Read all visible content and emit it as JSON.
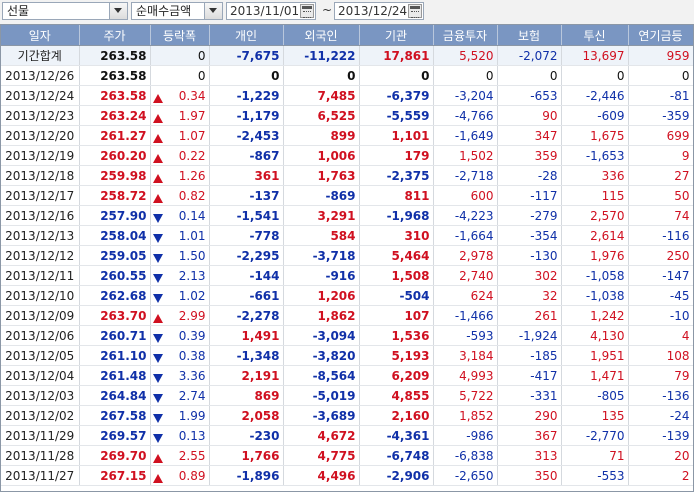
{
  "toolbar": {
    "market_select": "선물",
    "type_select": "순매수금액",
    "date_from": "2013/11/01",
    "date_to": "2013/12/24",
    "separator": "~"
  },
  "columns": [
    "일자",
    "주가",
    "등락폭",
    "개인",
    "외국인",
    "기관",
    "금융투자",
    "보험",
    "투신",
    "연기금등"
  ],
  "total": {
    "label": "기간합계",
    "price": "263.58",
    "chg": "0",
    "individual": "-7,675",
    "foreign": "-11,222",
    "inst": "17,861",
    "fin": "5,520",
    "insurance": "-2,072",
    "trust": "13,697",
    "pension": "959"
  },
  "rows": [
    {
      "date": "2013/12/26",
      "price": "263.58",
      "dir": "none",
      "chg": "0",
      "individual": "0",
      "foreign": "0",
      "inst": "0",
      "fin": "0",
      "insurance": "0",
      "trust": "0",
      "pension": "0"
    },
    {
      "date": "2013/12/24",
      "price": "263.58",
      "dir": "up",
      "chg": "0.34",
      "individual": "-1,229",
      "foreign": "7,485",
      "inst": "-6,379",
      "fin": "-3,204",
      "insurance": "-653",
      "trust": "-2,446",
      "pension": "-81"
    },
    {
      "date": "2013/12/23",
      "price": "263.24",
      "dir": "up",
      "chg": "1.97",
      "individual": "-1,179",
      "foreign": "6,525",
      "inst": "-5,559",
      "fin": "-4,766",
      "insurance": "90",
      "trust": "-609",
      "pension": "-359"
    },
    {
      "date": "2013/12/20",
      "price": "261.27",
      "dir": "up",
      "chg": "1.07",
      "individual": "-2,453",
      "foreign": "899",
      "inst": "1,101",
      "fin": "-1,649",
      "insurance": "347",
      "trust": "1,675",
      "pension": "699"
    },
    {
      "date": "2013/12/19",
      "price": "260.20",
      "dir": "up",
      "chg": "0.22",
      "individual": "-867",
      "foreign": "1,006",
      "inst": "179",
      "fin": "1,502",
      "insurance": "359",
      "trust": "-1,653",
      "pension": "9"
    },
    {
      "date": "2013/12/18",
      "price": "259.98",
      "dir": "up",
      "chg": "1.26",
      "individual": "361",
      "foreign": "1,763",
      "inst": "-2,375",
      "fin": "-2,718",
      "insurance": "-28",
      "trust": "336",
      "pension": "27"
    },
    {
      "date": "2013/12/17",
      "price": "258.72",
      "dir": "up",
      "chg": "0.82",
      "individual": "-137",
      "foreign": "-869",
      "inst": "811",
      "fin": "600",
      "insurance": "-117",
      "trust": "115",
      "pension": "50"
    },
    {
      "date": "2013/12/16",
      "price": "257.90",
      "dir": "down",
      "chg": "0.14",
      "individual": "-1,541",
      "foreign": "3,291",
      "inst": "-1,968",
      "fin": "-4,223",
      "insurance": "-279",
      "trust": "2,570",
      "pension": "74"
    },
    {
      "date": "2013/12/13",
      "price": "258.04",
      "dir": "down",
      "chg": "1.01",
      "individual": "-778",
      "foreign": "584",
      "inst": "310",
      "fin": "-1,664",
      "insurance": "-354",
      "trust": "2,614",
      "pension": "-116"
    },
    {
      "date": "2013/12/12",
      "price": "259.05",
      "dir": "down",
      "chg": "1.50",
      "individual": "-2,295",
      "foreign": "-3,718",
      "inst": "5,464",
      "fin": "2,978",
      "insurance": "-130",
      "trust": "1,976",
      "pension": "250"
    },
    {
      "date": "2013/12/11",
      "price": "260.55",
      "dir": "down",
      "chg": "2.13",
      "individual": "-144",
      "foreign": "-916",
      "inst": "1,508",
      "fin": "2,740",
      "insurance": "302",
      "trust": "-1,058",
      "pension": "-147"
    },
    {
      "date": "2013/12/10",
      "price": "262.68",
      "dir": "down",
      "chg": "1.02",
      "individual": "-661",
      "foreign": "1,206",
      "inst": "-504",
      "fin": "624",
      "insurance": "32",
      "trust": "-1,038",
      "pension": "-45"
    },
    {
      "date": "2013/12/09",
      "price": "263.70",
      "dir": "up",
      "chg": "2.99",
      "individual": "-2,278",
      "foreign": "1,862",
      "inst": "107",
      "fin": "-1,466",
      "insurance": "261",
      "trust": "1,242",
      "pension": "-10"
    },
    {
      "date": "2013/12/06",
      "price": "260.71",
      "dir": "down",
      "chg": "0.39",
      "individual": "1,491",
      "foreign": "-3,094",
      "inst": "1,536",
      "fin": "-593",
      "insurance": "-1,924",
      "trust": "4,130",
      "pension": "4"
    },
    {
      "date": "2013/12/05",
      "price": "261.10",
      "dir": "down",
      "chg": "0.38",
      "individual": "-1,348",
      "foreign": "-3,820",
      "inst": "5,193",
      "fin": "3,184",
      "insurance": "-185",
      "trust": "1,951",
      "pension": "108"
    },
    {
      "date": "2013/12/04",
      "price": "261.48",
      "dir": "down",
      "chg": "3.36",
      "individual": "2,191",
      "foreign": "-8,564",
      "inst": "6,209",
      "fin": "4,993",
      "insurance": "-417",
      "trust": "1,471",
      "pension": "79"
    },
    {
      "date": "2013/12/03",
      "price": "264.84",
      "dir": "down",
      "chg": "2.74",
      "individual": "869",
      "foreign": "-5,019",
      "inst": "4,855",
      "fin": "5,722",
      "insurance": "-331",
      "trust": "-805",
      "pension": "-136"
    },
    {
      "date": "2013/12/02",
      "price": "267.58",
      "dir": "down",
      "chg": "1.99",
      "individual": "2,058",
      "foreign": "-3,689",
      "inst": "2,160",
      "fin": "1,852",
      "insurance": "290",
      "trust": "135",
      "pension": "-24"
    },
    {
      "date": "2013/11/29",
      "price": "269.57",
      "dir": "down",
      "chg": "0.13",
      "individual": "-230",
      "foreign": "4,672",
      "inst": "-4,361",
      "fin": "-986",
      "insurance": "367",
      "trust": "-2,770",
      "pension": "-139"
    },
    {
      "date": "2013/11/28",
      "price": "269.70",
      "dir": "up",
      "chg": "2.55",
      "individual": "1,766",
      "foreign": "4,775",
      "inst": "-6,748",
      "fin": "-6,838",
      "insurance": "313",
      "trust": "71",
      "pension": "20"
    },
    {
      "date": "2013/11/27",
      "price": "267.15",
      "dir": "up",
      "chg": "0.89",
      "individual": "-1,896",
      "foreign": "4,496",
      "inst": "-2,906",
      "fin": "-2,650",
      "insurance": "350",
      "trust": "-553",
      "pension": "2"
    }
  ]
}
